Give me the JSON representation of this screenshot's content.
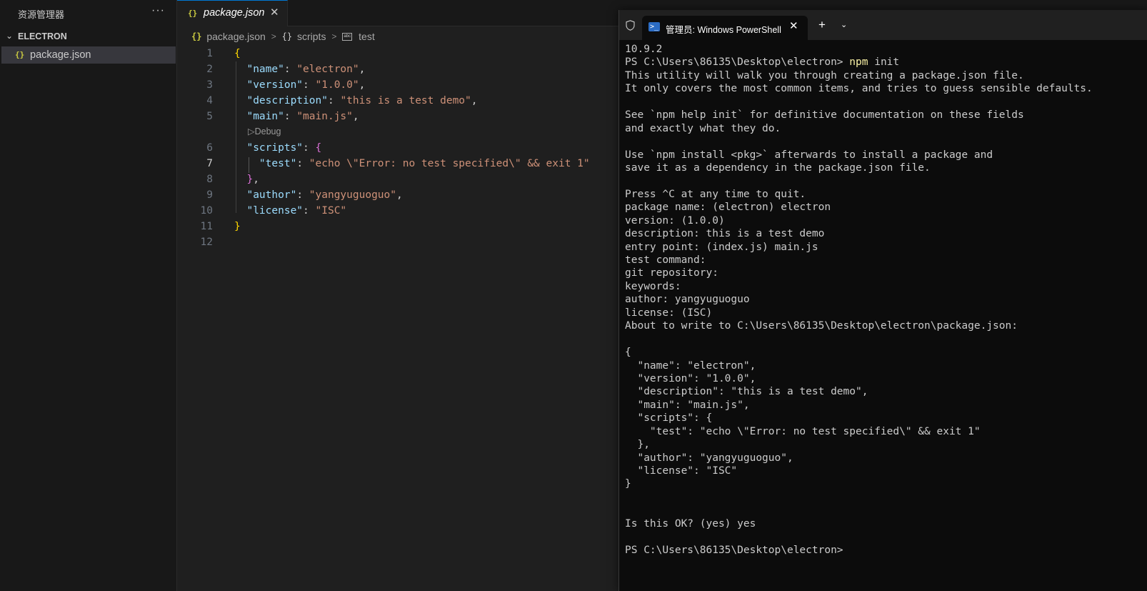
{
  "explorer": {
    "title": "资源管理器",
    "more": "···",
    "section": "ELECTRON",
    "file": "package.json",
    "file_icon": "{}"
  },
  "tab": {
    "label": "package.json",
    "icon": "{}",
    "close": "✕"
  },
  "breadcrumb": {
    "file": "package.json",
    "scripts": "scripts",
    "test": "test"
  },
  "editor": {
    "codelens": "Debug",
    "line_numbers": [
      "1",
      "2",
      "3",
      "4",
      "5",
      "6",
      "7",
      "8",
      "9",
      "10",
      "11",
      "12"
    ],
    "active_line": "7",
    "lines": [
      [
        {
          "t": "{",
          "c": "b1"
        }
      ],
      [
        {
          "t": "  "
        },
        {
          "t": "\"name\"",
          "c": "k"
        },
        {
          "t": ": ",
          "c": "p"
        },
        {
          "t": "\"electron\"",
          "c": "s"
        },
        {
          "t": ",",
          "c": "p"
        }
      ],
      [
        {
          "t": "  "
        },
        {
          "t": "\"version\"",
          "c": "k"
        },
        {
          "t": ": ",
          "c": "p"
        },
        {
          "t": "\"1.0.0\"",
          "c": "s"
        },
        {
          "t": ",",
          "c": "p"
        }
      ],
      [
        {
          "t": "  "
        },
        {
          "t": "\"description\"",
          "c": "k"
        },
        {
          "t": ": ",
          "c": "p"
        },
        {
          "t": "\"this is a test demo\"",
          "c": "s"
        },
        {
          "t": ",",
          "c": "p"
        }
      ],
      [
        {
          "t": "  "
        },
        {
          "t": "\"main\"",
          "c": "k"
        },
        {
          "t": ": ",
          "c": "p"
        },
        {
          "t": "\"main.js\"",
          "c": "s"
        },
        {
          "t": ",",
          "c": "p"
        }
      ],
      [
        {
          "t": "  "
        },
        {
          "t": "\"scripts\"",
          "c": "k"
        },
        {
          "t": ": ",
          "c": "p"
        },
        {
          "t": "{",
          "c": "b2"
        }
      ],
      [
        {
          "t": "    "
        },
        {
          "t": "\"test\"",
          "c": "k"
        },
        {
          "t": ": ",
          "c": "p"
        },
        {
          "t": "\"echo \\\"Error: no test specified\\\" && exit 1\"",
          "c": "s"
        }
      ],
      [
        {
          "t": "  "
        },
        {
          "t": "}",
          "c": "b2"
        },
        {
          "t": ",",
          "c": "p"
        }
      ],
      [
        {
          "t": "  "
        },
        {
          "t": "\"author\"",
          "c": "k"
        },
        {
          "t": ": ",
          "c": "p"
        },
        {
          "t": "\"yangyuguoguo\"",
          "c": "s"
        },
        {
          "t": ",",
          "c": "p"
        }
      ],
      [
        {
          "t": "  "
        },
        {
          "t": "\"license\"",
          "c": "k"
        },
        {
          "t": ": ",
          "c": "p"
        },
        {
          "t": "\"ISC\"",
          "c": "s"
        }
      ],
      [
        {
          "t": "}",
          "c": "b1"
        }
      ],
      []
    ]
  },
  "terminal": {
    "tab_title": "管理员: Windows PowerShell",
    "tab_close": "✕",
    "new_tab": "+",
    "dropdown": "⌄",
    "lines": [
      [
        {
          "t": "10.9.2"
        }
      ],
      [
        {
          "t": "PS C:\\Users\\86135\\Desktop\\electron> "
        },
        {
          "t": "npm",
          "c": "cmd"
        },
        {
          "t": " init"
        }
      ],
      [
        {
          "t": "This utility will walk you through creating a package.json file."
        }
      ],
      [
        {
          "t": "It only covers the most common items, and tries to guess sensible defaults."
        }
      ],
      [
        {
          "t": ""
        }
      ],
      [
        {
          "t": "See `npm help init` for definitive documentation on these fields"
        }
      ],
      [
        {
          "t": "and exactly what they do."
        }
      ],
      [
        {
          "t": ""
        }
      ],
      [
        {
          "t": "Use `npm install <pkg>` afterwards to install a package and"
        }
      ],
      [
        {
          "t": "save it as a dependency in the package.json file."
        }
      ],
      [
        {
          "t": ""
        }
      ],
      [
        {
          "t": "Press ^C at any time to quit."
        }
      ],
      [
        {
          "t": "package name: (electron) electron"
        }
      ],
      [
        {
          "t": "version: (1.0.0)"
        }
      ],
      [
        {
          "t": "description: this is a test demo"
        }
      ],
      [
        {
          "t": "entry point: (index.js) main.js"
        }
      ],
      [
        {
          "t": "test command:"
        }
      ],
      [
        {
          "t": "git repository:"
        }
      ],
      [
        {
          "t": "keywords:"
        }
      ],
      [
        {
          "t": "author: yangyuguoguo"
        }
      ],
      [
        {
          "t": "license: (ISC)"
        }
      ],
      [
        {
          "t": "About to write to C:\\Users\\86135\\Desktop\\electron\\package.json:"
        }
      ],
      [
        {
          "t": ""
        }
      ],
      [
        {
          "t": "{"
        }
      ],
      [
        {
          "t": "  \"name\": \"electron\","
        }
      ],
      [
        {
          "t": "  \"version\": \"1.0.0\","
        }
      ],
      [
        {
          "t": "  \"description\": \"this is a test demo\","
        }
      ],
      [
        {
          "t": "  \"main\": \"main.js\","
        }
      ],
      [
        {
          "t": "  \"scripts\": {"
        }
      ],
      [
        {
          "t": "    \"test\": \"echo \\\"Error: no test specified\\\" && exit 1\""
        }
      ],
      [
        {
          "t": "  },"
        }
      ],
      [
        {
          "t": "  \"author\": \"yangyuguoguo\","
        }
      ],
      [
        {
          "t": "  \"license\": \"ISC\""
        }
      ],
      [
        {
          "t": "}"
        }
      ],
      [
        {
          "t": ""
        }
      ],
      [
        {
          "t": ""
        }
      ],
      [
        {
          "t": "Is this OK? (yes) yes"
        }
      ],
      [
        {
          "t": ""
        }
      ],
      [
        {
          "t": "PS C:\\Users\\86135\\Desktop\\electron>"
        }
      ]
    ]
  },
  "colors": {
    "editor_bg": "#1f1f1f",
    "sidebar_bg": "#181818",
    "terminal_bg": "#0c0c0c",
    "json_key": "#9cdcfe",
    "json_string": "#ce9178",
    "bracket_gold": "#ffd700",
    "bracket_purple": "#da70d6",
    "command_yellow": "#f9f1a5",
    "tab_accent": "#0078d4"
  },
  "icons": [
    "more-actions-icon",
    "chevron-down-icon",
    "json-file-icon",
    "close-icon",
    "chevron-right-icon",
    "braces-icon",
    "string-symbol-icon",
    "play-icon",
    "shield-icon",
    "powershell-icon",
    "plus-icon"
  ]
}
